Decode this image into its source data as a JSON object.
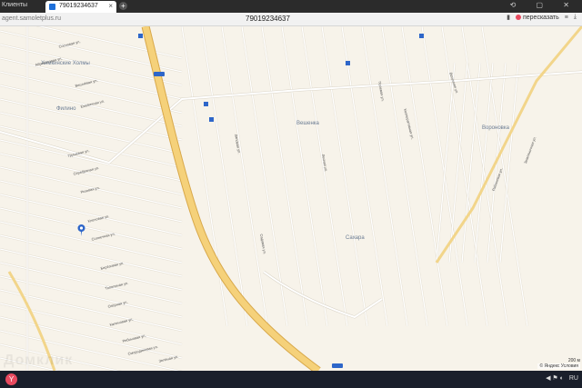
{
  "browser": {
    "side_label": "Клиенты",
    "tab_title": "79019234637",
    "tab_close": "×",
    "new_tab": "+",
    "window_buttons": "⟲ ▢ ✕",
    "url": "agent.samoletplus.ru",
    "page_title": "79019234637",
    "share_label": "пересказать"
  },
  "map": {
    "place_labels": [
      "Химкинские Холмы",
      "Филино",
      "Вешенка",
      "Сахара",
      "Вороновка"
    ],
    "road_badges": [
      "М-3",
      "М-3"
    ],
    "street_labels": [
      "Сосновая ул.",
      "Абрикосовая ул.",
      "Вишнёвая ул.",
      "Ежевичная ул.",
      "Грушевая ул.",
      "Серебряная ул.",
      "Розовая ул.",
      "Кленовая ул.",
      "Солнечная ул.",
      "Берёзовая ул.",
      "Тополиная ул.",
      "Озёрная ул.",
      "Каленовая ул.",
      "Рябиновая ул.",
      "Смородиновая ул.",
      "Зелёная ул.",
      "Липовая ул.",
      "Садовая ул.",
      "Лесная ул.",
      "Полевая ул.",
      "Весенняя ул.",
      "Кооперативная ул.",
      "Рябиновая ул.",
      "Земляничная ул."
    ],
    "copyright": "© Яндекс Условия",
    "scale": "200 м",
    "watermark": "Домклик"
  },
  "taskbar": {
    "start_label": "Y",
    "tray_text": "RU",
    "tray_icons": "◀ ⚑ ◐"
  },
  "colors": {
    "map_bg": "#f7f3ea",
    "highway": "#f5d17a",
    "highway_border": "#d8a84a",
    "road": "#ffffff",
    "road_border": "#d9d3c6",
    "badge": "#2e66c9",
    "marker": "#2e66c9"
  }
}
